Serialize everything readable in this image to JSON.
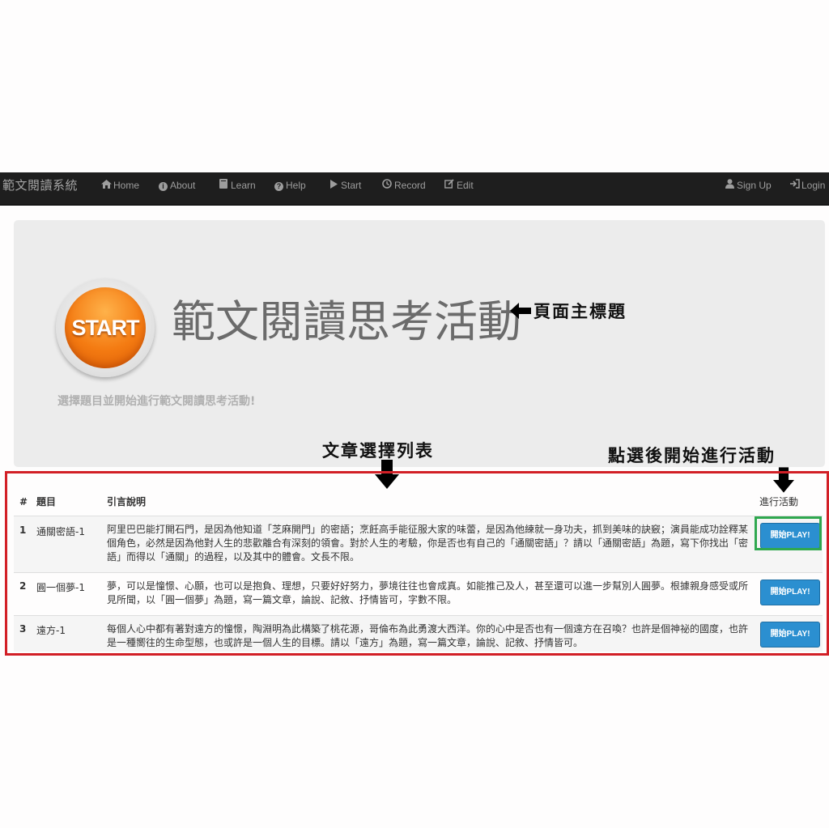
{
  "navbar": {
    "brand": "範文閱讀系統",
    "items": [
      {
        "label": "Home",
        "icon": "home-icon"
      },
      {
        "label": "About",
        "icon": "info-icon"
      },
      {
        "label": "Learn",
        "icon": "book-icon"
      },
      {
        "label": "Help",
        "icon": "question-icon"
      },
      {
        "label": "Start",
        "icon": "play-icon"
      },
      {
        "label": "Record",
        "icon": "clock-icon"
      },
      {
        "label": "Edit",
        "icon": "edit-icon"
      }
    ],
    "right_items": [
      {
        "label": "Sign Up",
        "icon": "user-icon"
      },
      {
        "label": "Login",
        "icon": "login-icon"
      }
    ]
  },
  "jumbotron": {
    "logo_text": "START",
    "title": "範文閱讀思考活動",
    "subtitle": "選擇題目並開始進行範文閱讀思考活動!"
  },
  "annotations": {
    "title_note": "頁面主標題",
    "list_note": "文章選擇列表",
    "action_note": "點選後開始進行活動"
  },
  "table": {
    "headers": {
      "num": "#",
      "title": "題目",
      "desc": "引言說明",
      "action": "進行活動"
    },
    "rows": [
      {
        "num": "1",
        "title": "通關密語-1",
        "desc": "阿里巴巴能打開石門，是因為他知道「芝麻開門」的密語；烹飪高手能征服大家的味蕾，是因為他練就一身功夫，抓到美味的訣竅；演員能成功詮釋某個角色，必然是因為他對人生的悲歡離合有深刻的領會。對於人生的考驗，你是否也有自己的「通關密語」？請以「通關密語」為題，寫下你找出「密語」而得以「通關」的過程，以及其中的體會。文長不限。",
        "button": "開始PLAY!"
      },
      {
        "num": "2",
        "title": "圓一個夢-1",
        "desc": "夢，可以是憧憬、心願，也可以是抱負、理想，只要好好努力，夢境往往也會成真。如能推己及人，甚至還可以進一步幫別人圓夢。根據親身感受或所見所聞，以「圓一個夢」為題，寫一篇文章，論說、記敘、抒情皆可，字數不限。",
        "button": "開始PLAY!"
      },
      {
        "num": "3",
        "title": "遠方-1",
        "desc": "每個人心中都有著對遠方的憧憬，陶淵明為此構築了桃花源，哥倫布為此勇渡大西洋。你的心中是否也有一個遠方在召喚？也許是個神祕的國度，也許是一種嚮往的生命型態，也或許是一個人生的目標。請以「遠方」為題，寫一篇文章，論說、記敘、抒情皆可。",
        "button": "開始PLAY!"
      }
    ]
  },
  "colors": {
    "navbar_bg": "#1e1e1e",
    "jumbotron_bg": "#ececec",
    "button_bg": "#2b8fd0",
    "red_highlight": "#d21f26",
    "green_highlight": "#2fa84f"
  }
}
